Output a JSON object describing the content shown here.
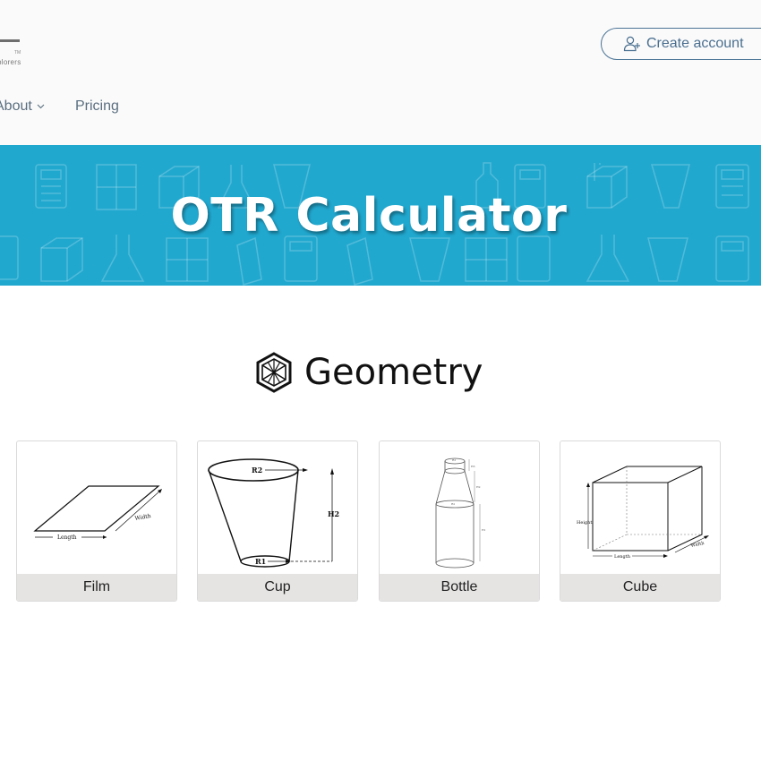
{
  "header": {
    "logo": {
      "tm": "TM",
      "text": "plorers"
    },
    "create_account_label": "Create account",
    "nav": {
      "about_label": "About",
      "pricing_label": "Pricing"
    }
  },
  "banner": {
    "title": "OTR Calculator",
    "background_color": "#21a8cf"
  },
  "section": {
    "title": "Geometry"
  },
  "cards": [
    {
      "label": "Film",
      "diagram_labels": {
        "length": "Length",
        "width": "Width"
      }
    },
    {
      "label": "Cup",
      "diagram_labels": {
        "r2": "R2",
        "r1": "R1",
        "h2": "H2"
      }
    },
    {
      "label": "Bottle",
      "diagram_labels": {
        "top_radius": "R3",
        "neck_height": "H3",
        "mid_height": "H2",
        "shoulder_radius": "R2",
        "body_height": "H1"
      }
    },
    {
      "label": "Cube",
      "diagram_labels": {
        "height": "Height",
        "length": "Length",
        "width": "Width"
      }
    }
  ],
  "colors": {
    "banner": "#21a8cf",
    "button_border": "#4a7396",
    "card_label_bg": "#e6e4e3"
  },
  "icons": {
    "create_account": "user-plus-icon",
    "about_chevron": "chevron-down-icon",
    "geometry": "geometry-cube-icon"
  }
}
